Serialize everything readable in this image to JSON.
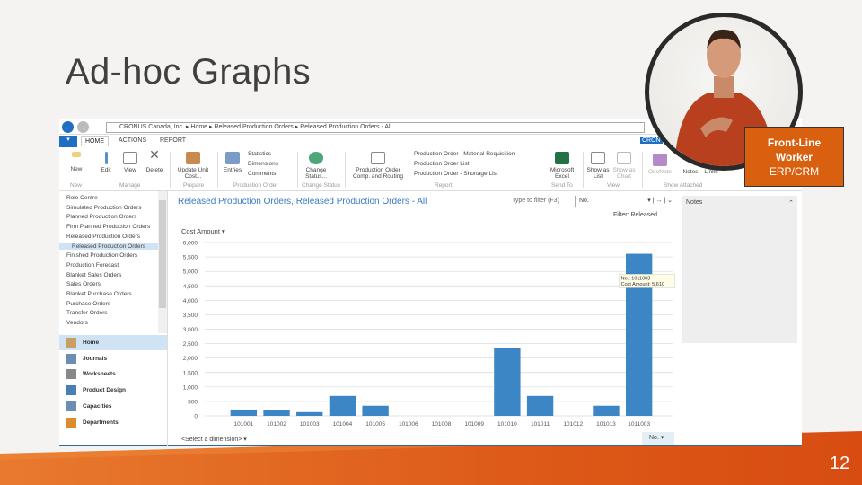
{
  "slide": {
    "title": "Ad-hoc Graphs",
    "page_number": "12",
    "badge_lines": [
      "Front-Line",
      "Worker",
      "ERP/CRM"
    ],
    "accent": "#d9600f"
  },
  "window": {
    "breadcrumb": [
      "CRONUS Canada, Inc.",
      "Home",
      "Released Production Orders",
      "Released Production Orders - All"
    ],
    "tabs": [
      "HOME",
      "ACTIONS",
      "REPORT"
    ],
    "company_badge": "CRON",
    "ribbon": {
      "buttons": {
        "new": "New",
        "edit": "Edit",
        "view": "View",
        "delete": "Delete",
        "update_unit_cost": "Update Unit Cost...",
        "entries": "Entries",
        "statistics": "Statistics",
        "dimensions": "Dimensions",
        "comments": "Comments",
        "change_status": "Change Status...",
        "prod_comp_routing": "Production Order Comp. and Routing",
        "report_material": "Production Order - Material Requisition",
        "report_list": "Production Order List",
        "report_shortage": "Production Order - Shortage List",
        "excel": "Microsoft Excel",
        "show_list": "Show as List",
        "show_chart": "Show as Chart",
        "onenote": "OneNote",
        "notes": "Notes",
        "links": "Links"
      },
      "groups": {
        "new": "New",
        "manage": "Manage",
        "prepare": "Prepare",
        "production_order": "Production Order",
        "change_status": "Change Status",
        "report": "Report",
        "send_to": "Send To",
        "view": "View",
        "show_attached": "Show Attached"
      }
    },
    "nav": {
      "items": [
        "Role Centre",
        "Simulated Production Orders",
        "Planned Production Orders",
        "Firm Planned Production Orders",
        "Released Production Orders",
        "Released Production Orders",
        "Finished Production Orders",
        "Production Forecast",
        "Blanket Sales Orders",
        "Sales Orders",
        "Blanket Purchase Orders",
        "Purchase Orders",
        "Transfer Orders",
        "Vendors"
      ],
      "selected_index": 5,
      "buttons": [
        "Home",
        "Journals",
        "Worksheets",
        "Product Design",
        "Capacities",
        "Departments"
      ]
    },
    "page": {
      "title": "Released Production Orders, Released Production Orders - All",
      "filter_placeholder": "Type to filter (F3)",
      "filter_field": "No.",
      "filter_label": "Filter: Released",
      "measure": "Cost Amount",
      "dimension_select": "<Select a dimension>",
      "x_select": "No.",
      "tooltip_line1": "No.: 1011003",
      "tooltip_line2": "Cost Amount: 5,610"
    },
    "notes_title": "Notes"
  },
  "chart_data": {
    "type": "bar",
    "title": "",
    "xlabel": "",
    "ylabel": "Cost Amount",
    "categories": [
      "101001",
      "101002",
      "101003",
      "101004",
      "101005",
      "101006",
      "101008",
      "101009",
      "101010",
      "101011",
      "101012",
      "101013",
      "1011003"
    ],
    "values": [
      220,
      190,
      130,
      690,
      350,
      0,
      0,
      0,
      2350,
      690,
      0,
      350,
      5610
    ],
    "ylim": [
      0,
      6000
    ],
    "yticks": [
      "0",
      "500",
      "1,000",
      "1,500",
      "2,000",
      "2,500",
      "3,000",
      "3,500",
      "4,000",
      "4,500",
      "5,000",
      "5,500",
      "6,000"
    ],
    "grid": true,
    "bar_color": "#3d86c6"
  }
}
